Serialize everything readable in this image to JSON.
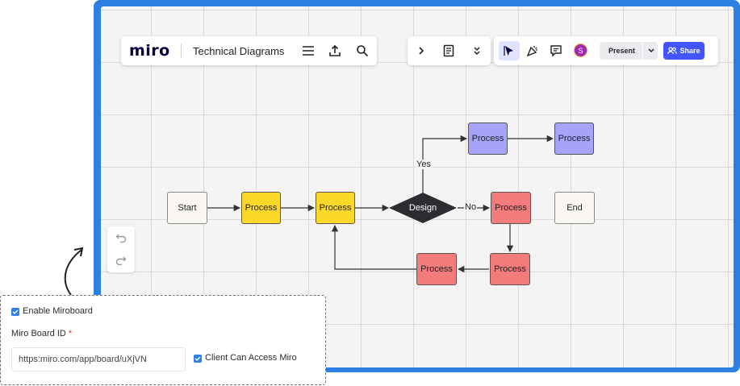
{
  "app": {
    "logo": "miro",
    "board_title": "Technical Diagrams"
  },
  "toolbar": {
    "menu_icon": "hamburger-menu-icon",
    "export_icon": "upload-icon",
    "search_icon": "search-icon",
    "expand_icon": "chevron-right-icon",
    "notes_icon": "document-icon",
    "collapse_icon": "chevrons-down-icon",
    "select_icon": "cursor-icon",
    "reactions_icon": "celebration-icon",
    "comment_icon": "comment-icon",
    "avatar_initial": "S",
    "present_label": "Present",
    "share_label": "Share"
  },
  "history": {
    "undo_icon": "undo-icon",
    "redo_icon": "redo-icon"
  },
  "diagram": {
    "nodes": {
      "start": "Start",
      "p1": "Process",
      "p2": "Process",
      "decision": "Design",
      "p_top1": "Process",
      "p_top2": "Process",
      "p_red1": "Process",
      "end": "End",
      "p_red2": "Process",
      "p_red3": "Process"
    },
    "labels": {
      "yes": "Yes",
      "no": "No"
    }
  },
  "settings_panel": {
    "enable_label": "Enable Miroboard",
    "enable_checked": true,
    "board_id_label": "Miro Board ID",
    "required_mark": "*",
    "board_id_value": "https:miro.com/app/board/uXjVN",
    "client_access_label": "Client Can Access Miro",
    "client_access_checked": true
  },
  "colors": {
    "frame_blue": "#2d7fe3",
    "share_blue": "#4255ff",
    "process_yellow": "#fcd828",
    "process_purple": "#a6a3fb",
    "process_red": "#f37b7b",
    "decision_dark": "#2b2d31"
  }
}
